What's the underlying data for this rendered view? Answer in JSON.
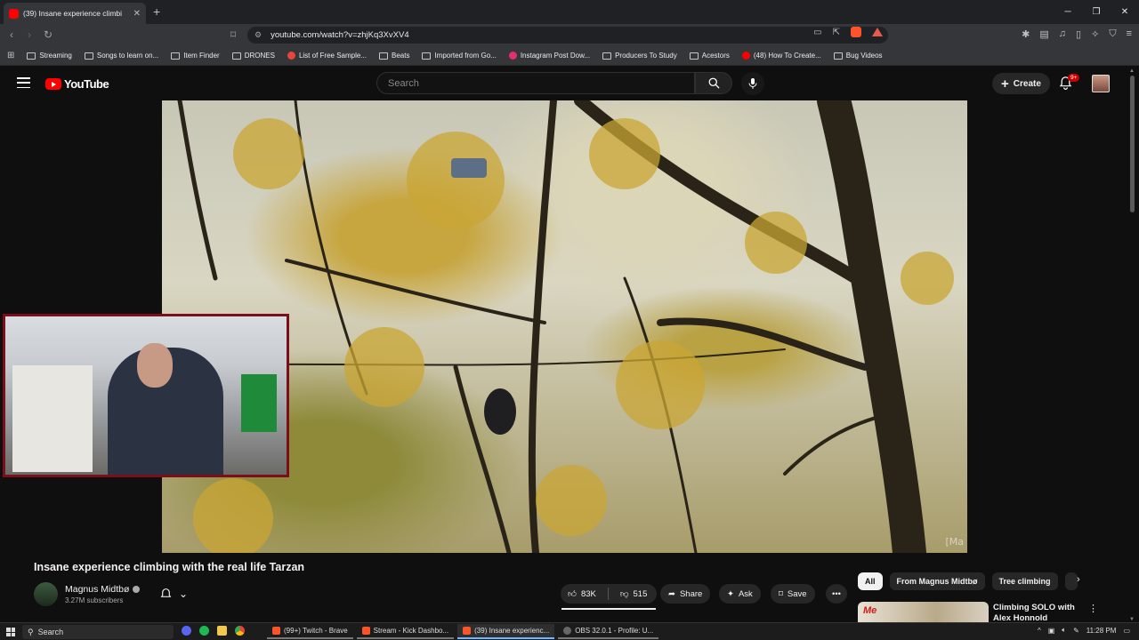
{
  "browser": {
    "tab_title": "(39) Insane experience climbi",
    "url": "youtube.com/watch?v=zhjKq3XvXV4",
    "bookmarks": [
      {
        "label": "Streaming",
        "icon": "folder"
      },
      {
        "label": "Songs to learn on...",
        "icon": "folder"
      },
      {
        "label": "Item Finder",
        "icon": "folder"
      },
      {
        "label": "DRONES",
        "icon": "folder"
      },
      {
        "label": "List of Free Sample...",
        "icon": "reddit"
      },
      {
        "label": "Beats",
        "icon": "folder"
      },
      {
        "label": "Imported from Go...",
        "icon": "folder"
      },
      {
        "label": "Instagram Post Dow...",
        "icon": "instagram"
      },
      {
        "label": "Producers To Study",
        "icon": "folder"
      },
      {
        "label": "Acestors",
        "icon": "folder"
      },
      {
        "label": "(48) How To Create...",
        "icon": "youtube"
      },
      {
        "label": "Bug Videos",
        "icon": "folder"
      }
    ]
  },
  "youtube": {
    "logo_text": "YouTube",
    "search_placeholder": "Search",
    "create_label": "Create",
    "notification_count": "9+"
  },
  "video": {
    "title": "Insane experience climbing with the real life Tarzan",
    "watermark": "[Ma",
    "channel_name": "Magnus Midtbø",
    "subscribers": "3.27M subscribers",
    "likes": "83K",
    "dislikes": "515",
    "share_label": "Share",
    "ask_label": "Ask",
    "save_label": "Save"
  },
  "chips": [
    "All",
    "From Magnus Midtbø",
    "Tree climbing"
  ],
  "related": {
    "title": "Climbing SOLO with Alex Honnold",
    "thumb_mark": "Me"
  },
  "taskbar": {
    "search_label": "Search",
    "apps": [
      {
        "label": "(99+) Twitch - Brave"
      },
      {
        "label": "Stream - Kick Dashbo..."
      },
      {
        "label": "(39) Insane experienc..."
      },
      {
        "label": "OBS 32.0.1 - Profile: U..."
      }
    ],
    "clock": "11:28 PM"
  },
  "colors": {
    "accent_red": "#ff0000",
    "webcam_border": "#7a0e1a",
    "background": "#0f0f0f"
  }
}
